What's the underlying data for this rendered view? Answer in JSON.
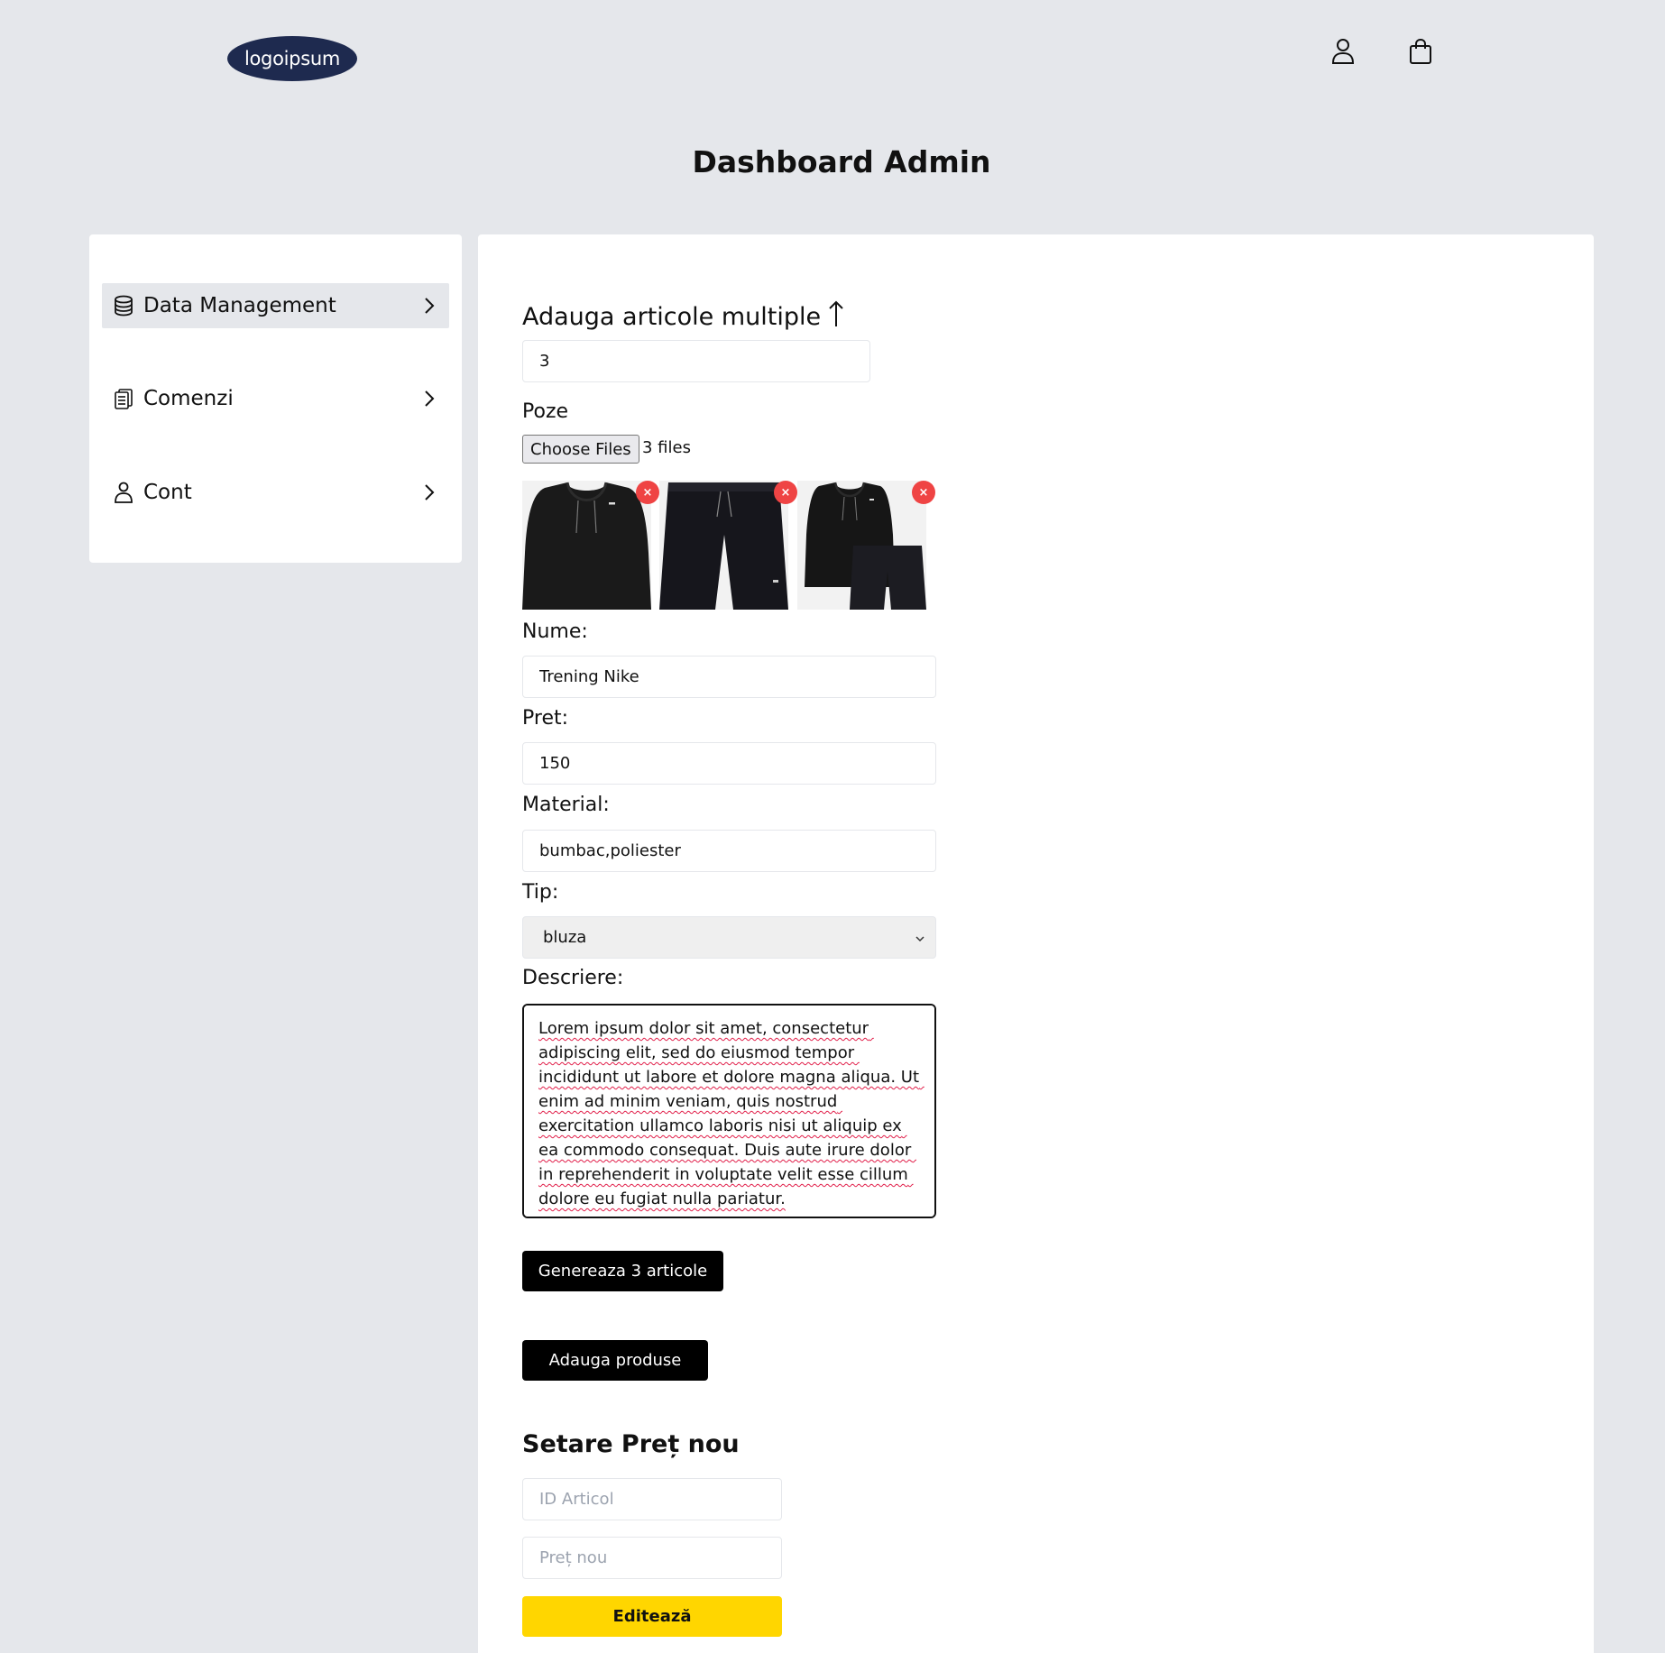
{
  "header": {
    "logo_text": "logoipsum",
    "user_icon": "user-icon",
    "bag_icon": "shopping-bag-icon"
  },
  "page_title": "Dashboard Admin",
  "sidebar": {
    "items": [
      {
        "label": "Data Management",
        "icon": "database-icon",
        "active": true
      },
      {
        "label": "Comenzi",
        "icon": "clipboard-list-icon",
        "active": false
      },
      {
        "label": "Cont",
        "icon": "user-icon",
        "active": false
      }
    ]
  },
  "form": {
    "section_title": "Adauga articole multiple",
    "section_icon": "arrow-up-icon",
    "quantity_value": "3",
    "images_label": "Poze",
    "file_button_label": "Choose Files",
    "file_status": "3 files",
    "thumbnails": [
      {
        "name": "hoodie-image",
        "remove_label": "×"
      },
      {
        "name": "shorts-image",
        "remove_label": "×"
      },
      {
        "name": "tracksuit-image",
        "remove_label": "×"
      }
    ],
    "name_label": "Nume:",
    "name_value": "Trening Nike",
    "price_label": "Pret:",
    "price_value": "150",
    "material_label": "Material:",
    "material_value": "bumbac,poliester",
    "type_label": "Tip:",
    "type_value": "bluza",
    "description_label": "Descriere:",
    "description_value": "Lorem ipsum dolor sit amet, consectetur adipiscing elit, sed do eiusmod tempor incididunt ut labore et dolore magna aliqua. Ut enim ad minim veniam, quis nostrud exercitation ullamco laboris nisi ut aliquip ex ea commodo consequat. Duis aute irure dolor in reprehenderit in voluptate velit esse cillum dolore eu fugiat nulla pariatur.",
    "generate_button_label": "Genereaza 3 articole",
    "add_button_label": "Adauga produse"
  },
  "price_section": {
    "title": "Setare Preț nou",
    "id_placeholder": "ID Articol",
    "price_placeholder": "Preț nou",
    "edit_button_label": "Editează"
  },
  "colors": {
    "background": "#e5e7eb",
    "logo_bg": "#1e2a4f",
    "primary_button": "#000000",
    "edit_button": "#ffd600",
    "remove_badge": "#ef4444"
  }
}
